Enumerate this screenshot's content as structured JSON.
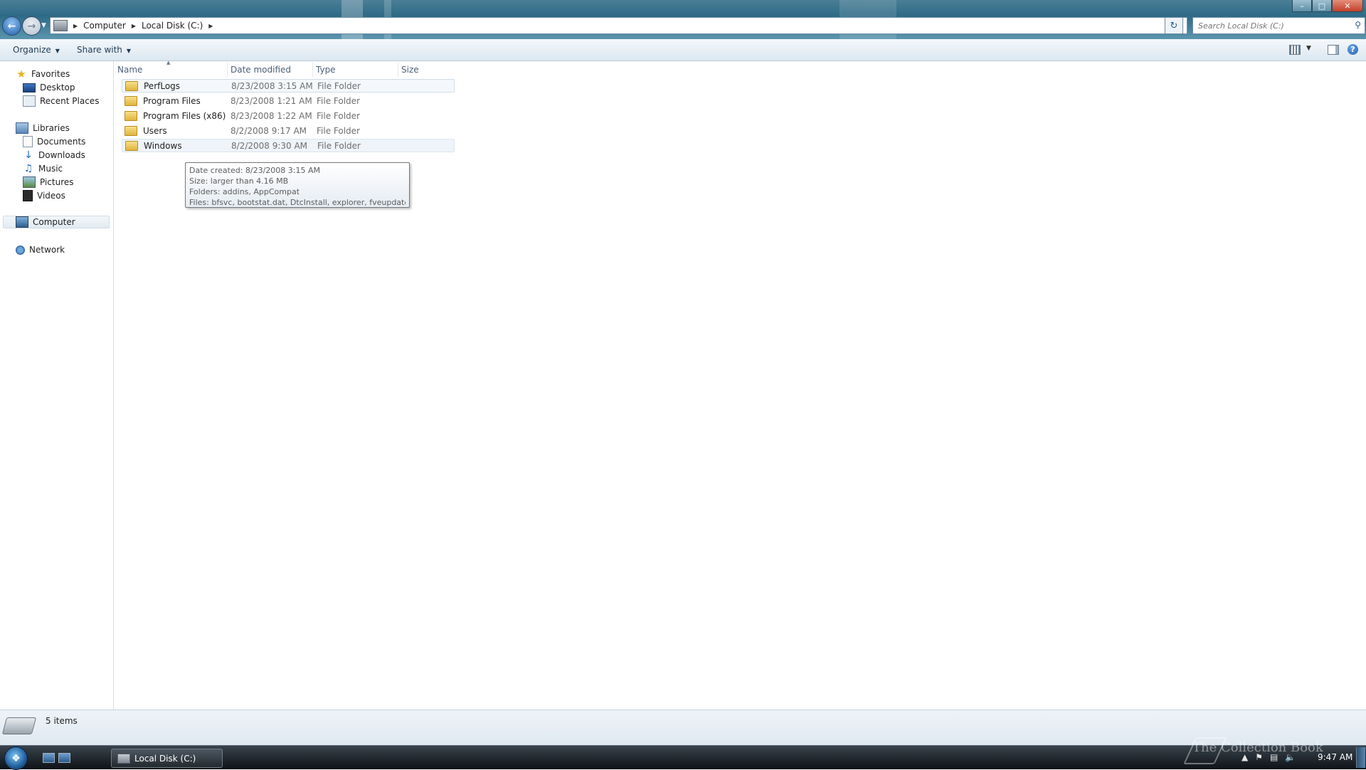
{
  "window": {
    "controls": [
      "minimize",
      "maximize",
      "close"
    ]
  },
  "address": {
    "breadcrumbs": [
      "Computer",
      "Local Disk (C:)"
    ]
  },
  "search": {
    "placeholder": "Search Local Disk (C:)"
  },
  "toolbar": {
    "organize_label": "Organize",
    "share_label": "Share with"
  },
  "nav": {
    "favorites": {
      "label": "Favorites",
      "items": [
        {
          "label": "Desktop",
          "icon": "desktop-icon"
        },
        {
          "label": "Recent Places",
          "icon": "recent-places-icon"
        }
      ]
    },
    "libraries": {
      "label": "Libraries",
      "items": [
        {
          "label": "Documents",
          "icon": "documents-icon"
        },
        {
          "label": "Downloads",
          "icon": "downloads-icon"
        },
        {
          "label": "Music",
          "icon": "music-icon"
        },
        {
          "label": "Pictures",
          "icon": "pictures-icon"
        },
        {
          "label": "Videos",
          "icon": "videos-icon"
        }
      ]
    },
    "computer_label": "Computer",
    "network_label": "Network"
  },
  "columns": {
    "name": "Name",
    "date": "Date modified",
    "type": "Type",
    "size": "Size"
  },
  "files": [
    {
      "name": "PerfLogs",
      "date": "8/23/2008 3:15 AM",
      "type": "File Folder"
    },
    {
      "name": "Program Files",
      "date": "8/23/2008 1:21 AM",
      "type": "File Folder"
    },
    {
      "name": "Program Files (x86)",
      "date": "8/23/2008 1:22 AM",
      "type": "File Folder"
    },
    {
      "name": "Users",
      "date": "8/2/2008 9:17 AM",
      "type": "File Folder"
    },
    {
      "name": "Windows",
      "date": "8/2/2008 9:30 AM",
      "type": "File Folder"
    }
  ],
  "tooltip": {
    "created": "Date created: 8/23/2008 3:15 AM",
    "size": "Size: larger than 4.16 MB",
    "folders": "Folders: addins, AppCompat",
    "files": "Files: bfsvc, bootstat.dat, DtcInstall, explorer, fveupdate, ..."
  },
  "status": {
    "items_count": "5 items"
  },
  "taskbar": {
    "task_label": "Local Disk (C:)",
    "clock": "9:47 AM"
  },
  "watermark": "The Collection Book",
  "colors": {
    "title_glass": "#2e6a86",
    "selection_border": "#cfdcea",
    "taskbar": "#0d1216"
  }
}
